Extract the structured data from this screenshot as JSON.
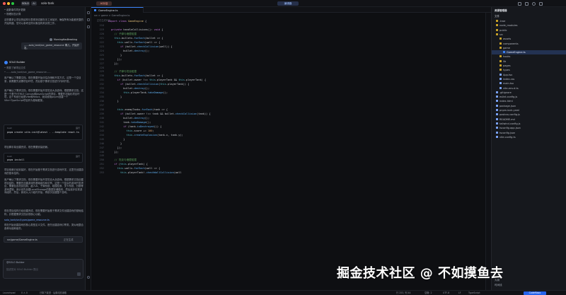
{
  "topbar": {
    "logo": "SOLO",
    "mode": "AI",
    "project": "solo-tank",
    "center_left": "编辑器",
    "center_right": "AI对话"
  },
  "chat": {
    "msg1": "• 函数事件同步更新",
    "msg2": "• 物理状态计算",
    "msg3": "这些要求让项目的结构与表现测试都在手工添加好，确保所有功能都完整的开始构建。您可以参考这样对象结构来实现工作。",
    "user_name": "MorningHasBreaking",
    "user_msg": "……solo_tank/src_game_resource 哪儿，开始开发。",
    "solo_label": "SOLO Builder",
    "step1": "• 需要了解项目文件",
    "step2": "• ……solo_tank/src_game_resource……",
    "para1": "用户确认了需要文档。现在需要开始评估存储和开发方式。这是一个空目录，我需要先设置项目环境，然后基于需求文档进行代码开发。",
    "para2": "用户确认了需求文档，现在需要开始开发坦克大战游戏。根据需求文档，这是一个基于HTML5 Canvas和JavaScript的项目，需要先初始化项目环境，这个系统已经是Vite和React，我将使用pnpm创建一个Vite+TypeScript项目作为基础框架。",
    "code1_label": "bash",
    "code1_action": "运行",
    "code1_text": "pnpm create vite-init@latest . --template react-ts",
    "mid1": "项目脚手架创建完成，现在需要安装依赖。",
    "code2_label": "bash",
    "code2_action": "运行",
    "code2_text": "pnpm install",
    "para3": "项目依赖已经安装好，现在开始基于需求文档进行游戏开发，这里先创建游戏的基本结构。",
    "para4": "用户确认了需求文档，现在需要开始开发坦克大战游戏。根据需求文档创建项目结构，需要先创建游戏的基础组件和引擎。这是一个复杂的游戏开发项目，需要包含坦克控制、敌人AI、子弹系统、碰撞检测、关卡系统、分数等游戏逻辑。我计划先创建LocalStorage的数据存储模块，然后逐步实现游戏组件。然后，我将从入口组件开始，再依次创建整个游戏。",
    "para5": "现在项目结构已经创建完成，现在需要开始基于需求文件创建游戏的基础结构，并根据需求文档实现核心功能。",
    "file_ref": "solo_tank/src/types/game_resource.ts",
    "para6": "现在开始创建游戏的核心类型定义文件。首先创建游戏引擎类，类似地整合各种功能和组件。",
    "pending_file": "src/game/GameEngine.ts",
    "pending_status": "正在生成",
    "mode_label": "@SOLO Builder",
    "input_placeholder": "描述您对 SOLO Builder 提出"
  },
  "editor": {
    "tab_label": "GameEngine.ts",
    "breadcrumb": "src  >  game  >  GameEngine.ts",
    "hint": "正在生成代码…",
    "header_line": "export class GameEngine {",
    "lines": [
      {
        "n": "218",
        "t": ""
      },
      {
        "n": "219",
        "t": "private handleCollisions(): void {"
      },
      {
        "n": "220",
        "t": "  // 子弹与墙壁碰撞"
      },
      {
        "n": "221",
        "t": "  this.bullets.forEach(bullet => {"
      },
      {
        "n": "222",
        "t": "    this.walls.forEach(wall => {"
      },
      {
        "n": "223",
        "t": "      if (bullet.checkCollision(wall)) {"
      },
      {
        "n": "224",
        "t": "        bullet.destroy();"
      },
      {
        "n": "225",
        "t": "      }"
      },
      {
        "n": "226",
        "t": "    });"
      },
      {
        "n": "227",
        "t": "  });"
      },
      {
        "n": "228",
        "t": ""
      },
      {
        "n": "229",
        "t": "  // 子弹与坦克碰撞"
      },
      {
        "n": "230",
        "t": "  this.bullets.forEach(bullet => {"
      },
      {
        "n": "231",
        "t": "    if (bullet.owner !== this.playerTank && this.playerTank) {"
      },
      {
        "n": "232",
        "t": "      if (bullet.checkCollision(this.playerTank)) {"
      },
      {
        "n": "233",
        "t": "        bullet.destroy();"
      },
      {
        "n": "234",
        "t": "        this.playerTank.takeDamage();"
      },
      {
        "n": "235",
        "t": "      }"
      },
      {
        "n": "236",
        "t": "    }"
      },
      {
        "n": "237",
        "t": ""
      },
      {
        "n": "238",
        "t": "    this.enemyTanks.forEach(tank => {"
      },
      {
        "n": "239",
        "t": "      if (bullet.owner !== tank && bullet.checkCollision(tank)) {"
      },
      {
        "n": "240",
        "t": "        bullet.destroy();"
      },
      {
        "n": "241",
        "t": "        tank.takeDamage();"
      },
      {
        "n": "242",
        "t": "        if (tank.isDestroyed()) {"
      },
      {
        "n": "243",
        "t": "          this.score += 100;"
      },
      {
        "n": "244",
        "t": "          this.createExplosion(tank.x, tank.y);"
      },
      {
        "n": "245",
        "t": "        }"
      },
      {
        "n": "246",
        "t": "      }"
      },
      {
        "n": "247",
        "t": "    });"
      },
      {
        "n": "248",
        "t": "  });"
      },
      {
        "n": "249",
        "t": ""
      },
      {
        "n": "250",
        "t": "  // 坦克与墙壁碰撞"
      },
      {
        "n": "251",
        "t": "  if (this.playerTank) {"
      },
      {
        "n": "252",
        "t": "    this.walls.forEach(wall => {"
      },
      {
        "n": "253",
        "t": "      this.playerTank!.checkWallCollision(wall"
      }
    ]
  },
  "explorer": {
    "title": "资源管理器",
    "root": "文件",
    "items": [
      {
        "label": ".trae",
        "depth": 0,
        "kind": "folder"
      },
      {
        "label": "node_modules",
        "depth": 0,
        "kind": "folder"
      },
      {
        "label": "public",
        "depth": 0,
        "kind": "folder"
      },
      {
        "label": "src",
        "depth": 0,
        "kind": "folder"
      },
      {
        "label": "assets",
        "depth": 1,
        "kind": "folder"
      },
      {
        "label": "components",
        "depth": 1,
        "kind": "folder"
      },
      {
        "label": "game",
        "depth": 1,
        "kind": "folder"
      },
      {
        "label": "GameEngine.ts",
        "depth": 2,
        "kind": "file-active"
      },
      {
        "label": "hooks",
        "depth": 1,
        "kind": "folder"
      },
      {
        "label": "lib",
        "depth": 1,
        "kind": "folder"
      },
      {
        "label": "pages",
        "depth": 1,
        "kind": "folder"
      },
      {
        "label": "types",
        "depth": 1,
        "kind": "folder"
      },
      {
        "label": "App.tsx",
        "depth": 1,
        "kind": "file"
      },
      {
        "label": "index.css",
        "depth": 1,
        "kind": "file"
      },
      {
        "label": "main.tsx",
        "depth": 1,
        "kind": "file"
      },
      {
        "label": "vite-env.d.ts",
        "depth": 1,
        "kind": "file"
      },
      {
        "label": ".gitignore",
        "depth": 0,
        "kind": "file"
      },
      {
        "label": "eslint.config.js",
        "depth": 0,
        "kind": "file"
      },
      {
        "label": "index.html",
        "depth": 0,
        "kind": "file"
      },
      {
        "label": "package.json",
        "depth": 0,
        "kind": "file"
      },
      {
        "label": "pnpm-lock.yaml",
        "depth": 0,
        "kind": "file"
      },
      {
        "label": "postcss.config.js",
        "depth": 0,
        "kind": "file"
      },
      {
        "label": "README.md",
        "depth": 0,
        "kind": "file"
      },
      {
        "label": "tailwind.config.js",
        "depth": 0,
        "kind": "file"
      },
      {
        "label": "tsconfig.app.json",
        "depth": 0,
        "kind": "file"
      },
      {
        "label": "tsconfig.json",
        "depth": 0,
        "kind": "file"
      },
      {
        "label": "vite.config.ts",
        "depth": 0,
        "kind": "file"
      }
    ],
    "outline": "大纲",
    "timeline": "时间线"
  },
  "status": {
    "left1": "Launchpad",
    "left2": "0 ⚠ 0",
    "left3": "已取下载进 · 后置动态读取",
    "right1": "行 253, 列 44",
    "right2": "空格: 2",
    "right3": "UTF-8",
    "right4": "LF",
    "right5": "TypeScript",
    "right6": "CodeMaxx"
  },
  "watermark": "掘金技术社区 @ 不如摸鱼去",
  "colors": {
    "accent": "#3b82f6",
    "bg": "#0e0f12",
    "panel": "#15171c"
  }
}
